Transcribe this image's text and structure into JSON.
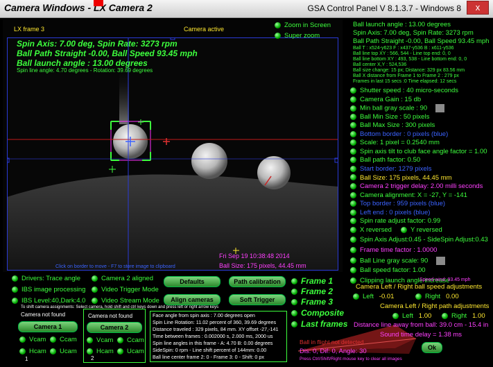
{
  "window": {
    "title": "Camera Windows - LX Camera 2",
    "panel_title": "GSA Control Panel V 8.1.3.7 - Windows 8",
    "close": "x"
  },
  "camera_view": {
    "frame_label": "LX frame 3",
    "status": "Camera active",
    "spin_line": "Spin Axis: 7.00 deg, Spin Rate: 3273 rpm",
    "path_line": "Ball Path Straight -0.00, Ball Speed 93.45 mph",
    "launch_line": "Ball launch angle : 13.00 degrees",
    "spin_small": "Spin line angle: 4.70 degrees - Rotation: 39.69 degrees",
    "timestamp": "Fri Sep 19 10:38:48 2014",
    "ball_size": "Ball Size: 175 pixels, 44.45 mm",
    "hint": "Click on border to move - F7 to store image to clipboard"
  },
  "zoom": {
    "zoom_in_screen": "Zoom in Screen",
    "super_zoom": "Super zoom"
  },
  "info": {
    "launch": "Ball launch angle : 13.00 degrees",
    "spin": "Spin Axis: 7.00 deg, Spin Rate: 3273 rpm",
    "path": "Ball Path Straight -0.00, Ball Speed 93.45 mph",
    "l1": "Ball T : x524-y623 F : x437-y536 B : x611-y536",
    "l2": "Ball line top XY : 566, 544 - Line top end: 0, 0",
    "l3": "Ball line bottom XY : 493, 538 - Line bottom end: 0, 0",
    "l4": "Ball center X,Y : 524,536",
    "l5": "Ball size change: 15 px; Distance: 329 px 83.56 mm",
    "l6": "Ball X distance from Frame 1 to Frame 2 : 279 px",
    "l7": "Frames in last 15 secs :0 Time elapsed: 12 secs"
  },
  "settings": [
    {
      "text": "Shutter speed : 40 micro-seconds",
      "color": "green",
      "dot": true
    },
    {
      "text": "Camera Gain : 15 db",
      "color": "green",
      "dot": true
    },
    {
      "text": "Min ball gray scale : 90",
      "color": "green",
      "dot": true,
      "square": true
    },
    {
      "text": "Ball Min Size : 50 pixels",
      "color": "green",
      "dot": true
    },
    {
      "text": "Ball Max Size : 300 pixels",
      "color": "green",
      "dot": true
    },
    {
      "text": "Bottom border : 0 pixels (blue)",
      "color": "blue",
      "dot": true
    },
    {
      "text": "Scale: 1 pixel = 0.2540 mm",
      "color": "green",
      "dot": true
    },
    {
      "text": "Spin axis tilt to club face angle factor = 1.00",
      "color": "green",
      "dot": true
    },
    {
      "text": "Ball path factor: 0.50",
      "color": "green",
      "dot": true
    },
    {
      "text": "Start border: 1279 pixels",
      "color": "blue",
      "dot": true
    },
    {
      "text": "Ball Size: 175 pixels, 44.45 mm",
      "color": "yellow",
      "dot": true
    },
    {
      "text": "Camera 2 trigger delay: 2.00 milli seconds",
      "color": "magenta",
      "dot": true
    },
    {
      "text": "Camera alignment: X = -27, Y = -141",
      "color": "green",
      "dot": true
    },
    {
      "text": "Top border : 959 pixels (blue)",
      "color": "blue",
      "dot": true
    },
    {
      "text": "Left end : 0 pixels (blue)",
      "color": "blue",
      "dot": true
    },
    {
      "text": "Spin rate adjust factor: 0.99",
      "color": "green",
      "dot": true
    }
  ],
  "reversed": {
    "x": "X reversed",
    "y": "Y reversed"
  },
  "settings2": [
    {
      "text": "Spin Axis Adjust:0.45 - SideSpin Adjust:0.43",
      "color": "green",
      "dot": true
    },
    {
      "text": "Frame time factor : 1.0000",
      "color": "magenta",
      "dot": true
    },
    {
      "text": "Ball Line gray scale: 90",
      "color": "green",
      "dot": true,
      "square": true
    },
    {
      "text": "Ball speed factor: 1.00",
      "color": "green",
      "dot": true
    },
    {
      "text": "Clipping launch angle increase",
      "color": "green",
      "dot": true
    }
  ],
  "speed_wind": "Speed wind: 93.45 mph",
  "lr_speed": {
    "title": "Camera Left / Right ball speed adjustments",
    "left_label": "Left",
    "left_val": "-0.01",
    "right_label": "Right",
    "right_val": "0.00"
  },
  "lr_path": {
    "title": "Camera Left / Right path adjustments",
    "left_label": "Left",
    "left_val": "1.00",
    "right_label": "Right",
    "right_val": "1.00"
  },
  "distance_line": "Distance line away from ball: 39.0 cm - 15.4 in",
  "sound_delay": "Sound time delay = 1.38 ms",
  "not_detected": "Ball in flight not detected",
  "dist_vals": "Dis: 0, Dif: 0, Angle: 30",
  "press_hint": "Press Ctrl/Shift/Right mouse key to clear all images",
  "ok": "Ok",
  "options": {
    "drivers": "Drivers: Trace angle",
    "camera2_aligned": "Camera 2 aligned",
    "ibs_processing": "IBS image processing",
    "video_trigger": "Video Trigger Mode",
    "ibs_level": "IBS Level:40,Dark:4.0",
    "video_stream": "Video Stream Mode",
    "shift_hint": "To shift camera assignments: Select camera, hold shift and ctrl keys down and press left or right arrow keys"
  },
  "buttons": {
    "defaults": "Defaults",
    "path_calibration": "Path calibration",
    "align_cameras": "Align cameras",
    "soft_trigger": "Soft Trigger"
  },
  "frames": {
    "f1": "Frame 1",
    "f2": "Frame 2",
    "f3": "Frame 3",
    "composite": "Composite",
    "last": "Last frames"
  },
  "cam1": {
    "status": "Camera not found",
    "btn": "Camera 1",
    "vcam": "Vcam",
    "ccam": "Ccam",
    "hcam": "Hcam",
    "ucam": "Ucam",
    "num": "1"
  },
  "cam2": {
    "status": "Camera not found",
    "btn": "Camera 2",
    "vcam": "Vcam",
    "ccam": "Ccam",
    "hcam": "Hcam",
    "ucam": "Ucam",
    "num": "2"
  },
  "stats": [
    "Face angle from spin axis : 7.00 degrees open",
    "Spin Line Rotation: 11.02 percent of 360, 39.69 degrees",
    "Distance traveled : 329 pixels, 84 mm. XY offset  -27,-141",
    "Time between frames : 0.002000 s, 2.000 ms, 2000 us",
    "Spin line angles in this frame - A: 4.70  B: 0.00 degrees",
    "SideSpin: 0 rpm - Line shift percent of 144mm: 0.00",
    "Ball line center frame 2: 0 - Frame 3: 0 - Shift: 0 px"
  ]
}
